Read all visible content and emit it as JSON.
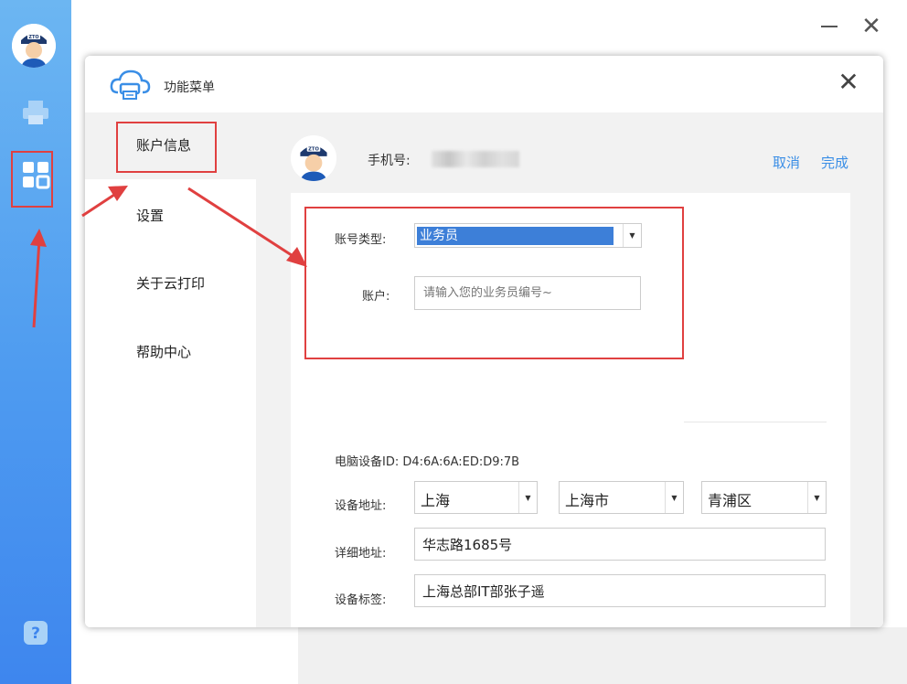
{
  "window": {
    "minimize_icon": "minimize-icon",
    "close_icon": "close-icon"
  },
  "sidebar": {
    "items": [
      {
        "icon": "printer-icon"
      },
      {
        "icon": "apps-grid-icon"
      },
      {
        "icon": "help-icon",
        "label": "?"
      }
    ]
  },
  "dialog": {
    "title": "功能菜单",
    "close_glyph": "✕",
    "menu": {
      "items": [
        {
          "label": "账户信息"
        },
        {
          "label": "设置"
        },
        {
          "label": "关于云打印"
        },
        {
          "label": "帮助中心"
        }
      ]
    },
    "account": {
      "phone_label": "手机号:",
      "cancel_label": "取消",
      "done_label": "完成",
      "type_label": "账号类型:",
      "type_value": "业务员",
      "account_label": "账户:",
      "account_placeholder": "请输入您的业务员编号~",
      "device_id_text": "电脑设备ID:  D4:6A:6A:ED:D9:7B",
      "addr_label": "设备地址:",
      "province": "上海",
      "city": "上海市",
      "district": "青浦区",
      "detail_label": "详细地址:",
      "detail_value": "华志路1685号",
      "tag_label": "设备标签:",
      "tag_value": "上海总部IT部张子遥"
    }
  },
  "colors": {
    "sidebar_top": "#6cb6f2",
    "sidebar_bottom": "#3e86ee",
    "link": "#3a8ee6",
    "highlight": "#e04040",
    "selection": "#3d7fd8"
  }
}
